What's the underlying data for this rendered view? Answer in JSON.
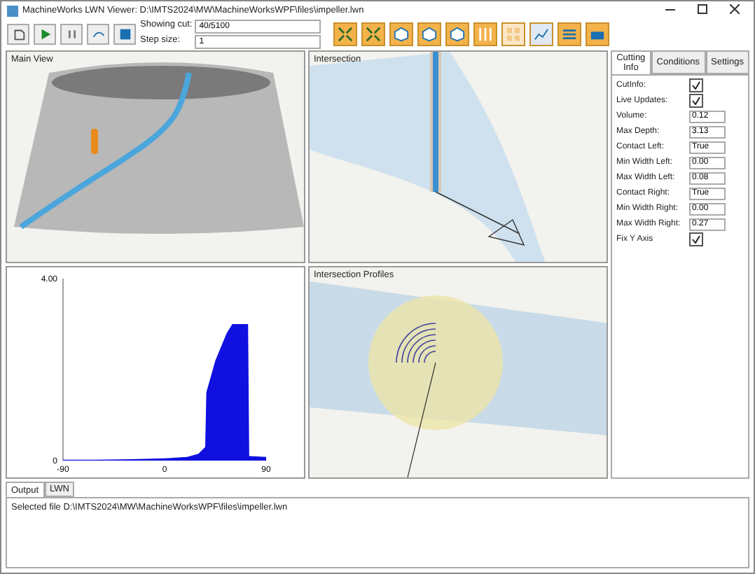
{
  "window": {
    "title": "MachineWorks LWN Viewer: D:\\IMTS2024\\MW\\MachineWorksWPF\\files\\impeller.lwn"
  },
  "toolbar": {
    "showing_cut_label": "Showing cut:",
    "showing_cut_value": "40/5100",
    "step_size_label": "Step size:",
    "step_size_value": "1"
  },
  "views": [
    {
      "title": "Main View",
      "kind": "main"
    },
    {
      "title": "Intersection",
      "kind": "intersection"
    },
    {
      "kind": "chart"
    },
    {
      "title": "Intersection Profiles",
      "kind": "profiles"
    }
  ],
  "chart_data": {
    "type": "area",
    "x": [
      -90,
      -60,
      -30,
      0,
      20,
      30,
      36,
      37,
      45,
      55,
      60,
      74,
      75,
      90
    ],
    "values": [
      0.02,
      0.02,
      0.03,
      0.05,
      0.08,
      0.15,
      0.3,
      1.5,
      2.2,
      2.8,
      3.0,
      3.0,
      0.1,
      0.08
    ],
    "xlim": [
      -90,
      90
    ],
    "ylim": [
      0,
      4
    ],
    "xticks": [
      -90,
      0,
      90
    ],
    "yticks": [
      0,
      {
        "value": 4,
        "label": "4.00"
      }
    ]
  },
  "side_tabs": [
    {
      "label": "Cutting Info",
      "selected": true
    },
    {
      "label": "Conditions",
      "selected": false
    },
    {
      "label": "Settings",
      "selected": false
    }
  ],
  "cutting_info": [
    {
      "label": "CutInfo:",
      "kind": "checkbox",
      "checked": true
    },
    {
      "label": "Live Updates:",
      "kind": "checkbox",
      "checked": true
    },
    {
      "label": "Volume:",
      "kind": "text",
      "value": "0.12"
    },
    {
      "label": "Max Depth:",
      "kind": "text",
      "value": "3.13"
    },
    {
      "label": "Contact Left:",
      "kind": "text",
      "value": "True"
    },
    {
      "label": "Min Width Left:",
      "kind": "text",
      "value": "0.00"
    },
    {
      "label": "Max Width Left:",
      "kind": "text",
      "value": "0.08"
    },
    {
      "label": "Contact Right:",
      "kind": "text",
      "value": "True"
    },
    {
      "label": "Min Width Right:",
      "kind": "text",
      "value": "0.00"
    },
    {
      "label": "Max Width Right:",
      "kind": "text",
      "value": "0.27"
    },
    {
      "label": "Fix Y Axis",
      "kind": "checkbox",
      "checked": true
    }
  ],
  "bottom_tabs": [
    {
      "label": "Output",
      "selected": true
    },
    {
      "label": "LWN",
      "selected": false
    }
  ],
  "output": "Selected file D:\\IMTS2024\\MW\\MachineWorksWPF\\files\\impeller.lwn"
}
